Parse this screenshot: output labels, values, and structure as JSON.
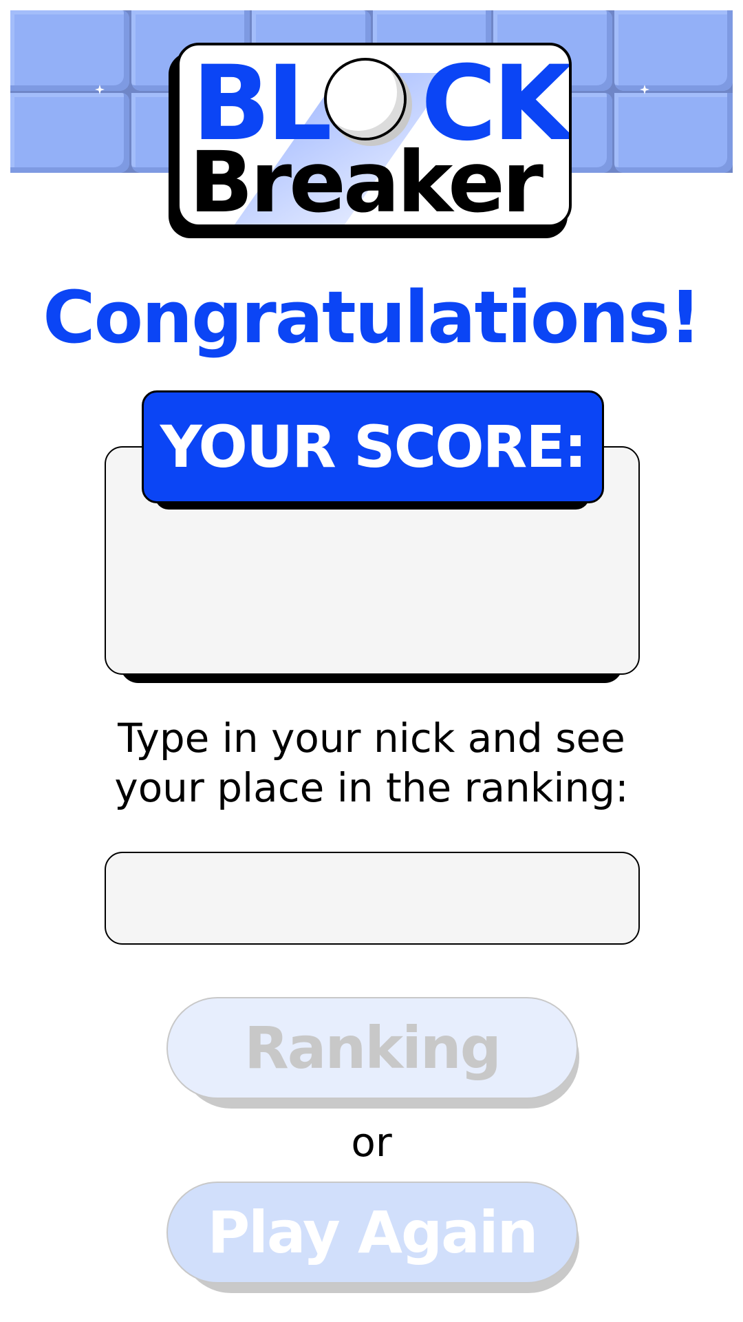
{
  "logo": {
    "line1_left": "BL",
    "line1_right": "CK",
    "line2": "Breaker"
  },
  "headline": "Congratulations!",
  "score": {
    "label": "YOUR SCORE:",
    "value": ""
  },
  "instructions": {
    "line1": "Type in your nick and see",
    "line2": "your place in the ranking:"
  },
  "nick_input": {
    "value": "",
    "placeholder": ""
  },
  "buttons": {
    "ranking": "Ranking",
    "separator": "or",
    "play_again": "Play Again"
  },
  "colors": {
    "brand_blue": "#0b45f5",
    "brick": "#93b0f7",
    "disabled_text": "#c8c8c8"
  }
}
